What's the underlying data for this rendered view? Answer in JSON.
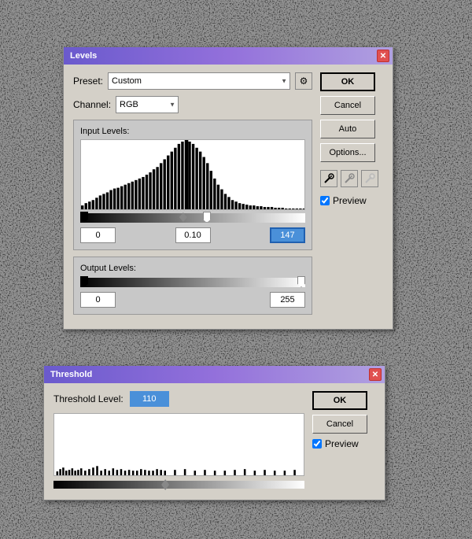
{
  "background": {
    "description": "Black and white cracked texture"
  },
  "levels_dialog": {
    "title": "Levels",
    "preset_label": "Preset:",
    "preset_value": "Custom",
    "channel_label": "Channel:",
    "channel_value": "RGB",
    "input_levels_label": "Input Levels:",
    "output_levels_label": "Output Levels:",
    "input_low": "0",
    "input_mid": "0.10",
    "input_high": "147",
    "output_low": "0",
    "output_high": "255",
    "ok_label": "OK",
    "cancel_label": "Cancel",
    "auto_label": "Auto",
    "options_label": "Options...",
    "preview_label": "Preview",
    "preview_checked": true,
    "gear_icon": "⚙",
    "eyedropper_black": "🖋",
    "eyedropper_gray": "🖋",
    "eyedropper_white": "🖋"
  },
  "threshold_dialog": {
    "title": "Threshold",
    "threshold_level_label": "Threshold Level:",
    "threshold_value": "110",
    "ok_label": "OK",
    "cancel_label": "Cancel",
    "preview_label": "Preview",
    "preview_checked": true
  }
}
